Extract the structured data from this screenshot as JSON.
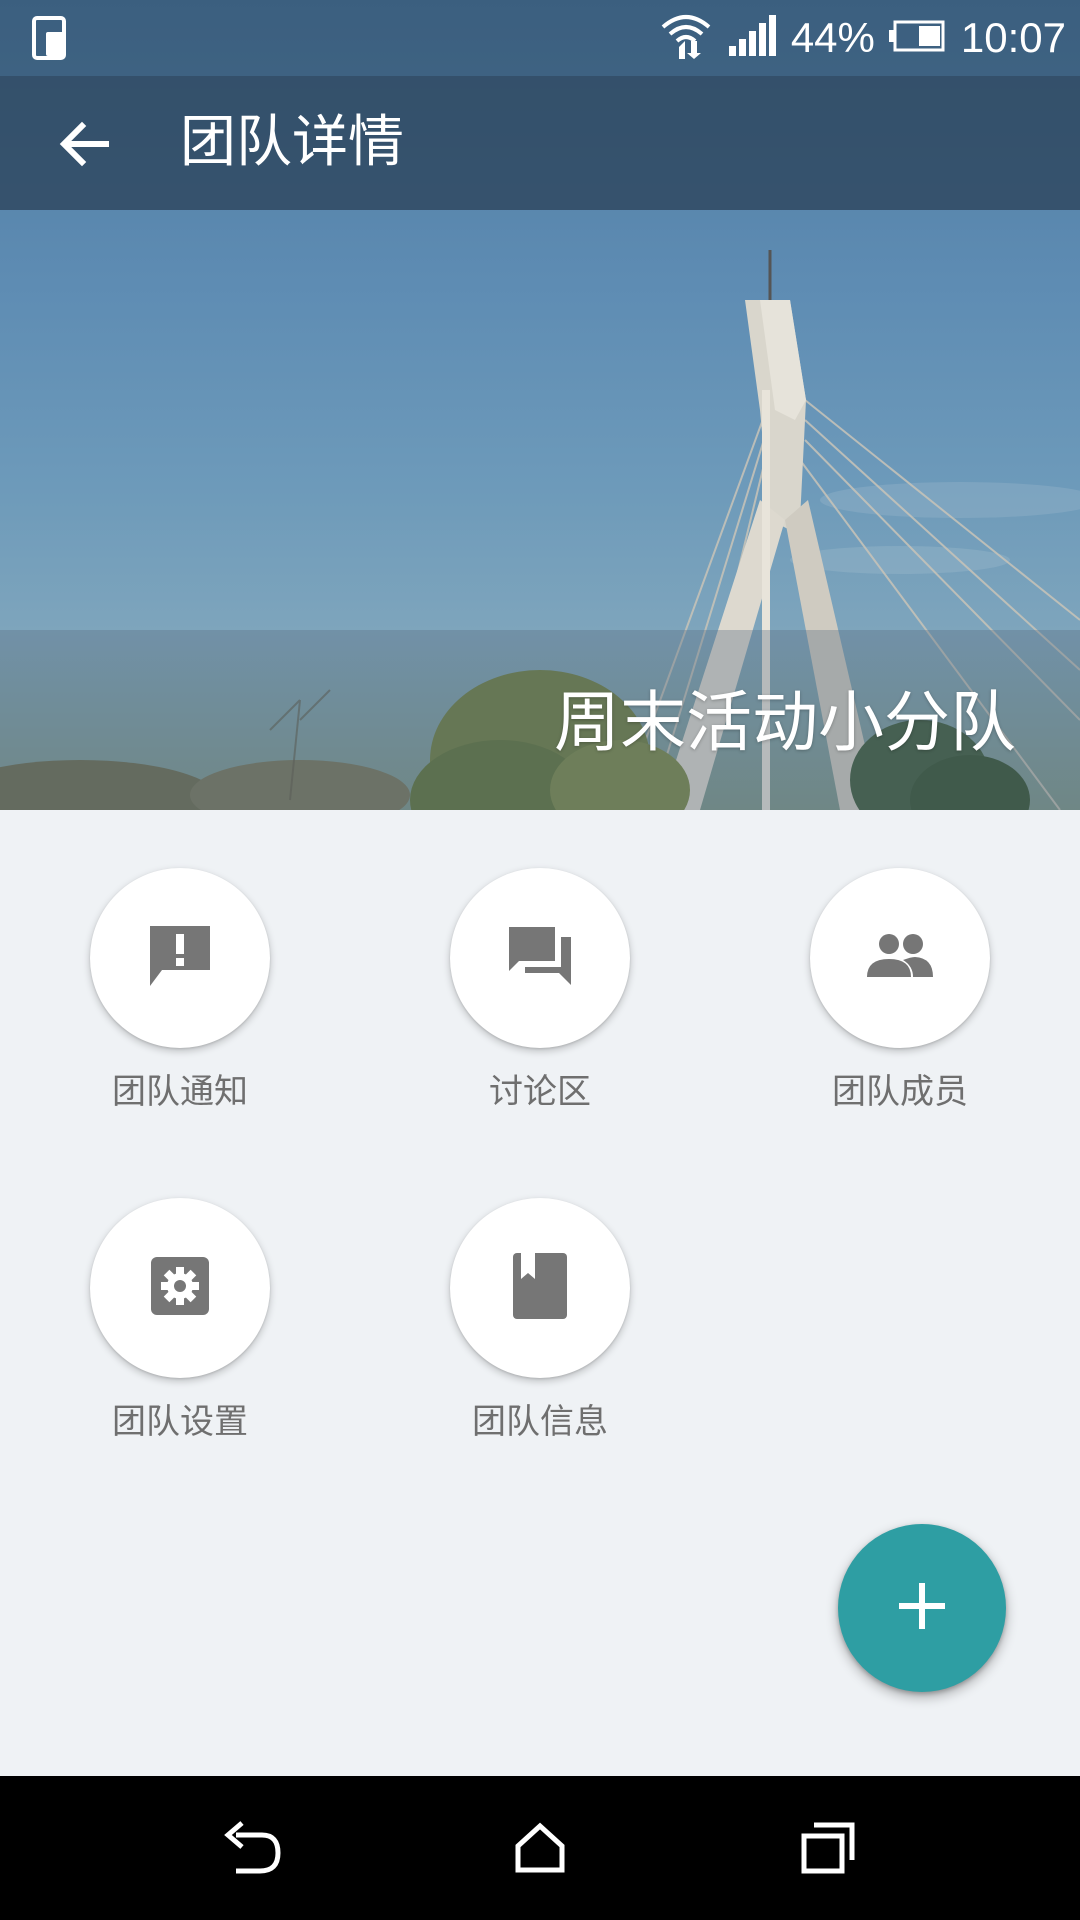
{
  "status_bar": {
    "battery_percent": "44%",
    "time": "10:07",
    "icons": [
      "phone-tablet-icon",
      "wifi-icon",
      "signal-icon",
      "battery-icon"
    ]
  },
  "app_bar": {
    "back_icon": "arrow-left-icon",
    "title": "团队详情"
  },
  "hero": {
    "team_name": "周末活动小分队"
  },
  "grid": {
    "items": [
      {
        "label": "团队通知",
        "icon": "announcement-icon"
      },
      {
        "label": "讨论区",
        "icon": "forum-icon"
      },
      {
        "label": "团队成员",
        "icon": "people-icon"
      },
      {
        "label": "团队设置",
        "icon": "settings-icon"
      },
      {
        "label": "团队信息",
        "icon": "book-icon"
      }
    ]
  },
  "fab": {
    "icon": "plus-icon"
  },
  "nav_bar": {
    "icons": [
      "back-icon",
      "home-icon",
      "recents-icon"
    ]
  },
  "colors": {
    "accent": "#2e9ea3",
    "icon_gray": "#767676",
    "background": "#eff2f5"
  }
}
